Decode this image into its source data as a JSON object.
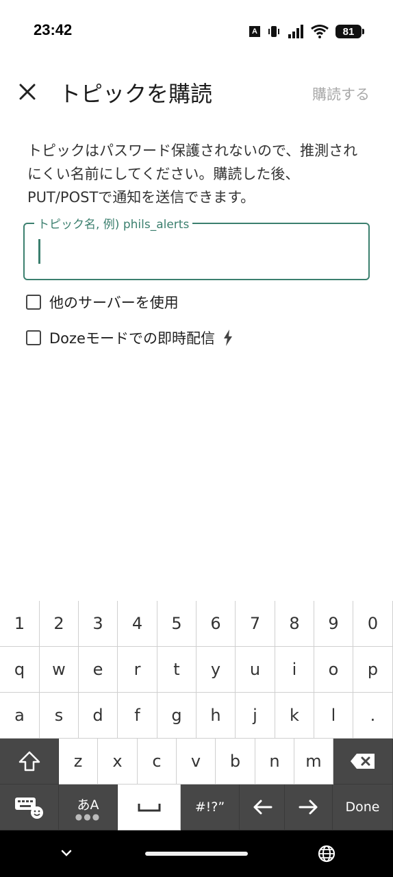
{
  "status_bar": {
    "time": "23:42",
    "input_indicator": "A",
    "battery": "81",
    "icons": [
      "vibrate-icon",
      "signal-icon",
      "wifi-icon",
      "battery-icon"
    ]
  },
  "app_bar": {
    "close_icon": "close-icon",
    "title": "トピックを購読",
    "subscribe_label": "購読する"
  },
  "description": "トピックはパスワード保護されないので、推測されにくい名前にしてください。購読した後、PUT/POSTで通知を送信できます。",
  "topic_field": {
    "label": "トピック名, 例) phils_alerts",
    "value": "",
    "accent": "#3b7f6e"
  },
  "options": [
    {
      "label": "他のサーバーを使用",
      "checked": false
    },
    {
      "label": "Dozeモードでの即時配信",
      "checked": false,
      "icon": "lightning-icon"
    }
  ],
  "keyboard": {
    "row_numbers": [
      "1",
      "2",
      "3",
      "4",
      "5",
      "6",
      "7",
      "8",
      "9",
      "0"
    ],
    "row_top": [
      "q",
      "w",
      "e",
      "r",
      "t",
      "y",
      "u",
      "i",
      "o",
      "p"
    ],
    "row_middle": [
      "a",
      "s",
      "d",
      "f",
      "g",
      "h",
      "j",
      "k",
      "l",
      "."
    ],
    "row_bottom": [
      "z",
      "x",
      "c",
      "v",
      "b",
      "n",
      "m"
    ],
    "lang_label": "あA",
    "symbols_label": "#!?”",
    "done_label": "Done"
  },
  "nav_bar": {
    "icons": [
      "chevron-down-icon",
      "home-pill",
      "globe-icon"
    ]
  }
}
